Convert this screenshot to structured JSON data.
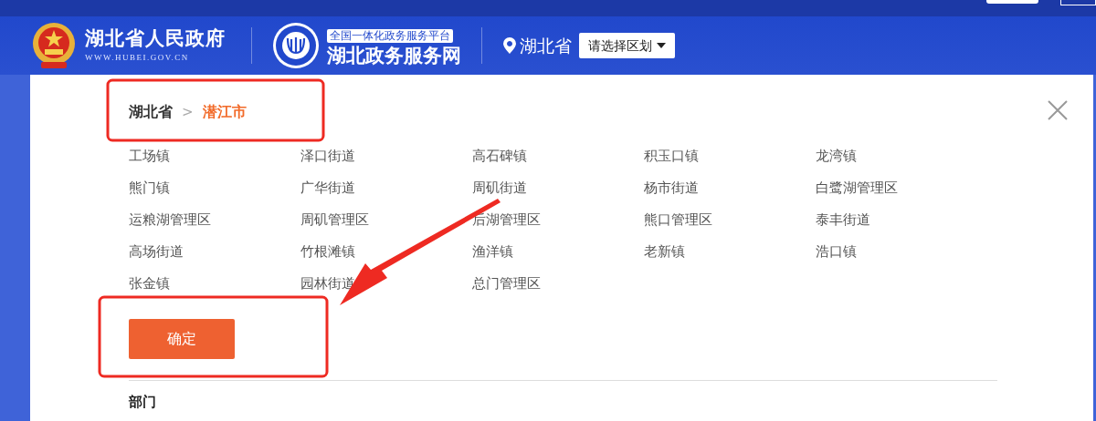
{
  "header": {
    "gov_title": "湖北省人民政府",
    "gov_url": "WWW.HUBEI.GOV.CN",
    "platform_tagline": "全国一体化政务服务平台",
    "platform_title": "湖北政务服务网",
    "location": "湖北省",
    "region_select": "请选择区划"
  },
  "breadcrumb": [
    {
      "label": "湖北省",
      "selected": false
    },
    {
      "label": "潜江市",
      "selected": true
    }
  ],
  "breadcrumb_separator": ">",
  "towns": [
    "工场镇",
    "泽口街道",
    "高石碑镇",
    "积玉口镇",
    "龙湾镇",
    "熊门镇",
    "广华街道",
    "周矶街道",
    "杨市街道",
    "白鹭湖管理区",
    "运粮湖管理区",
    "周矶管理区",
    "后湖管理区",
    "熊口管理区",
    "泰丰街道",
    "高场街道",
    "竹根滩镇",
    "渔洋镇",
    "老新镇",
    "浩口镇",
    "张金镇",
    "园林街道",
    "总门管理区"
  ],
  "confirm_button": "确定",
  "section_title": "部门"
}
